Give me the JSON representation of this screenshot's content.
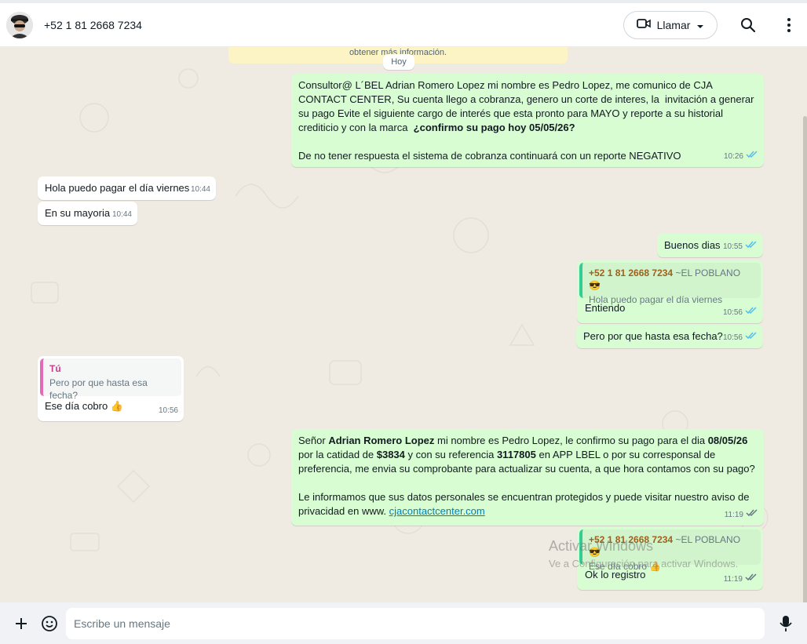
{
  "header": {
    "contact_name": "+52 1 81 2668 7234",
    "call_label": "Llamar",
    "icons": [
      "avatar",
      "video-camera-icon",
      "chevron-down-icon",
      "search-icon",
      "menu-dots-icon"
    ]
  },
  "chat": {
    "system_banner": "obtener más información.",
    "date_chip": "Hoy",
    "messages": [
      {
        "direction": "out",
        "parts": [
          "Consultor@ L´BEL Adrian Romero Lopez mi nombre es Pedro Lopez, me comunico de CJA CONTACT CENTER, Su cuenta llego a cobranza, genero un corte de interes, la  invitación a generar su pago Evite el siguiente cargo de interés que esta pronto para MAYO y reporte a su historial crediticio y con la marca ",
          " ¿confirmo su pago hoy 05/05/26?",
          "De no tener respuesta el sistema de cobranza continuará con un reporte NEGATIVO"
        ],
        "time": "10:26",
        "status": "read"
      },
      {
        "direction": "in",
        "text": "Hola puedo pagar el día viernes",
        "time": "10:44"
      },
      {
        "direction": "in",
        "text": "En su mayoria",
        "time": "10:44"
      },
      {
        "direction": "out",
        "text": "Buenos dias",
        "time": "10:55",
        "status": "read"
      },
      {
        "direction": "out",
        "quote": {
          "author": "+52 1 81 2668 7234",
          "aside": "~EL POBLANO 😎",
          "text": "Hola puedo pagar el día viernes"
        },
        "text": "Entiendo",
        "time": "10:56",
        "status": "read"
      },
      {
        "direction": "out",
        "text": "Pero por que hasta esa fecha?",
        "time": "10:56",
        "status": "read"
      },
      {
        "direction": "in",
        "quote": {
          "author": "Tú",
          "text": "Pero por que hasta esa fecha?"
        },
        "text": "Ese día cobro 👍",
        "time": "10:56"
      },
      {
        "direction": "out",
        "parts": [
          "Señor ",
          "Adrian Romero Lopez",
          " mi nombre es Pedro Lopez, le confirmo su pago para el dia ",
          "08/05/26",
          " por la catidad de ",
          "$3834",
          " y con su referencia ",
          "3117805",
          " en APP LBEL o por su corresponsal de preferencia, me envia su comprobante para actualizar su cuenta, a que hora contamos con su pago?",
          "Le informamos que sus datos personales se encuentran protegidos y puede visitar nuestro aviso de privacidad en www. ",
          "cjacontactcenter.com"
        ],
        "time": "11:19",
        "status": "delivered"
      },
      {
        "direction": "out",
        "quote": {
          "author": "+52 1 81 2668 7234",
          "aside": "~EL POBLANO 😎",
          "text": "Ese día cobro 👍"
        },
        "text": "Ok lo registro",
        "time": "11:19",
        "status": "delivered"
      }
    ]
  },
  "watermark": {
    "line1": "Activar Windows",
    "line2": "Ve a Configuración para activar Windows."
  },
  "composer": {
    "placeholder": "Escribe un mensaje",
    "icons": [
      "plus-icon",
      "sticker-icon",
      "microphone-icon"
    ]
  },
  "colors": {
    "outgoing_bubble": "#d9fdd3",
    "incoming_bubble": "#ffffff",
    "chat_background": "#efeae2",
    "read_tick": "#53bdeb",
    "quote_author_out": "#a05f1b",
    "quote_author_in": "#d3398f"
  }
}
